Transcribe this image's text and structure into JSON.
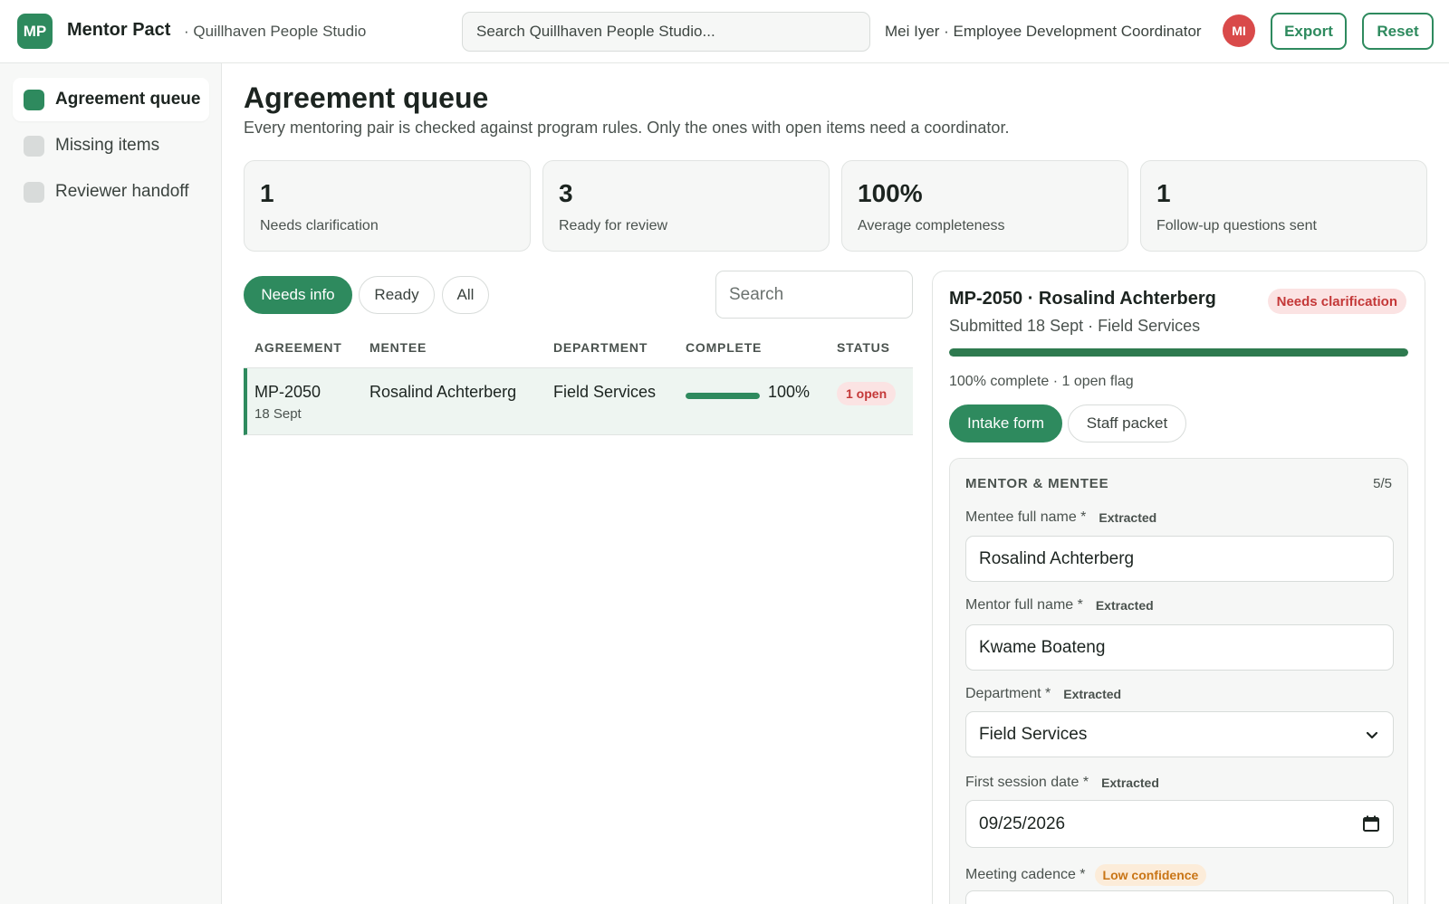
{
  "header": {
    "logo_initials": "MP",
    "app_name": "Mentor Pact",
    "org_name": "· Quillhaven People Studio",
    "search_placeholder": "Search Quillhaven People Studio...",
    "user_label": "Mei Iyer · Employee Development Coordinator",
    "avatar_initials": "MI",
    "export_label": "Export",
    "reset_label": "Reset"
  },
  "sidebar": {
    "items": [
      {
        "label": "Agreement queue",
        "active": true
      },
      {
        "label": "Missing items",
        "active": false
      },
      {
        "label": "Reviewer handoff",
        "active": false
      }
    ]
  },
  "main": {
    "title": "Agreement queue",
    "subtitle": "Every mentoring pair is checked against program rules. Only the ones with open items need a coordinator.",
    "stats": [
      {
        "value": "1",
        "label": "Needs clarification"
      },
      {
        "value": "3",
        "label": "Ready for review"
      },
      {
        "value": "100%",
        "label": "Average completeness"
      },
      {
        "value": "1",
        "label": "Follow-up questions sent"
      }
    ],
    "filters": [
      {
        "label": "Needs info",
        "active": true
      },
      {
        "label": "Ready",
        "active": false
      },
      {
        "label": "All",
        "active": false
      }
    ],
    "table_search_placeholder": "Search",
    "columns": [
      "AGREEMENT",
      "MENTEE",
      "DEPARTMENT",
      "COMPLETE",
      "STATUS"
    ],
    "rows": [
      {
        "agreement": "MP-2050",
        "date": "18 Sept",
        "mentee": "Rosalind Achterberg",
        "department": "Field Services",
        "complete_pct": 100,
        "complete_label": "100%",
        "status": "1 open"
      }
    ]
  },
  "detail": {
    "title": "MP-2050 · Rosalind Achterberg",
    "badge": "Needs clarification",
    "subtitle": "Submitted 18 Sept · Field Services",
    "progress_pct": 100,
    "progress_text": "100% complete · 1 open flag",
    "tabs": [
      {
        "label": "Intake form",
        "active": true
      },
      {
        "label": "Staff packet",
        "active": false
      }
    ],
    "section": {
      "title": "MENTOR & MENTEE",
      "count": "5/5",
      "fields": [
        {
          "label": "Mentee full name *",
          "tag": "Extracted",
          "value": "Rosalind Achterberg"
        },
        {
          "label": "Mentor full name *",
          "tag": "Extracted",
          "value": "Kwame Boateng"
        },
        {
          "label": "Department *",
          "tag": "Extracted",
          "value": "Field Services"
        },
        {
          "label": "First session date *",
          "tag": "Extracted",
          "value": "09/25/2026"
        },
        {
          "label": "Meeting cadence *",
          "tag": "Low confidence",
          "value": ""
        }
      ]
    }
  },
  "colors": {
    "accent": "#2e8a5e",
    "danger": "#c43838",
    "danger_bg": "#fbe3e3",
    "warning": "#c97516",
    "warning_bg": "#fcecd9",
    "avatar": "#d94a4a"
  }
}
